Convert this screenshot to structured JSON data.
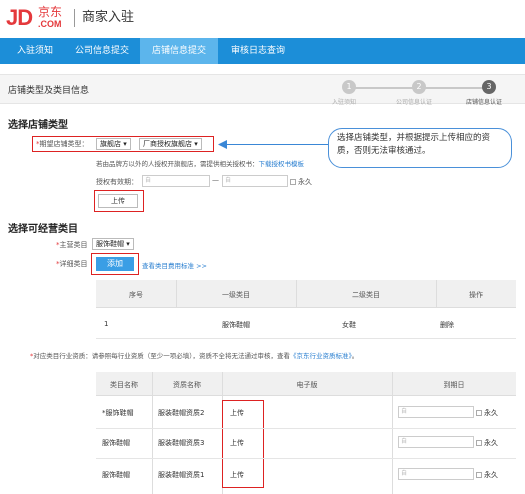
{
  "brand": {
    "logo_text": "JD",
    "logo_cn": "京东",
    "logo_com": ".COM",
    "site_title": "商家入驻",
    "color": "#e4393c"
  },
  "nav": {
    "items": [
      "入驻须知",
      "公司信息提交",
      "店铺信息提交",
      "审核日志查询"
    ],
    "active_index": 2,
    "color": "#1c8ed8"
  },
  "section": {
    "title": "店铺类型及类目信息",
    "steps": [
      {
        "num": "1",
        "label": "入驻须知"
      },
      {
        "num": "2",
        "label": "公司信息认证"
      },
      {
        "num": "3",
        "label": "店铺信息认证"
      }
    ]
  },
  "store_type": {
    "heading": "选择店铺类型",
    "label": "期望店铺类型：",
    "type_value": "旗舰店 ▾",
    "subtype_value": "厂商授权旗舰店 ▾",
    "hint": "若由品牌方以外的人授权开旗舰店，需提供相关授权书：",
    "hint_link": "下载授权书模板",
    "period_label": "授权有效期：",
    "from_placeholder": "自",
    "to_placeholder": "自",
    "dash": "—",
    "permanent": "永久",
    "upload_button": "上传",
    "tooltip": "选择店铺类型，并根据提示上传相应的资质，否则无法审核通过。"
  },
  "category": {
    "heading": "选择可经营类目",
    "main_label": "主营类目",
    "main_value": "服饰鞋帽 ▾",
    "detail_label": "详细类目",
    "add_button": "添加",
    "fee_link": "查看类目费用标准 >>",
    "table_headers": [
      "序号",
      "一级类目",
      "二级类目",
      "操作"
    ],
    "rows": [
      {
        "no": "1",
        "level1": "服饰鞋帽",
        "level2": "女鞋",
        "action": "删除"
      }
    ]
  },
  "qualification": {
    "label": "对应类目行业资质：",
    "hint": "请参照每行业资质（至少一项必填），资质不全将无法通过审核，查看",
    "hint_link": "《京东行业资质标准》",
    "hint_end": "。",
    "table_headers": [
      "类目名称",
      "资质名称",
      "电子版",
      "到期日"
    ],
    "rows": [
      {
        "cat": "*服饰鞋帽",
        "qual": "服装鞋帽资质2",
        "file": "上传",
        "date": "自",
        "permanent": "永久"
      },
      {
        "cat": "服饰鞋帽",
        "qual": "服装鞋帽资质3",
        "file": "上传",
        "date": "自",
        "permanent": "永久"
      },
      {
        "cat": "服饰鞋帽",
        "qual": "服装鞋帽资质1",
        "file": "上传",
        "date": "自",
        "permanent": "永久"
      }
    ]
  }
}
